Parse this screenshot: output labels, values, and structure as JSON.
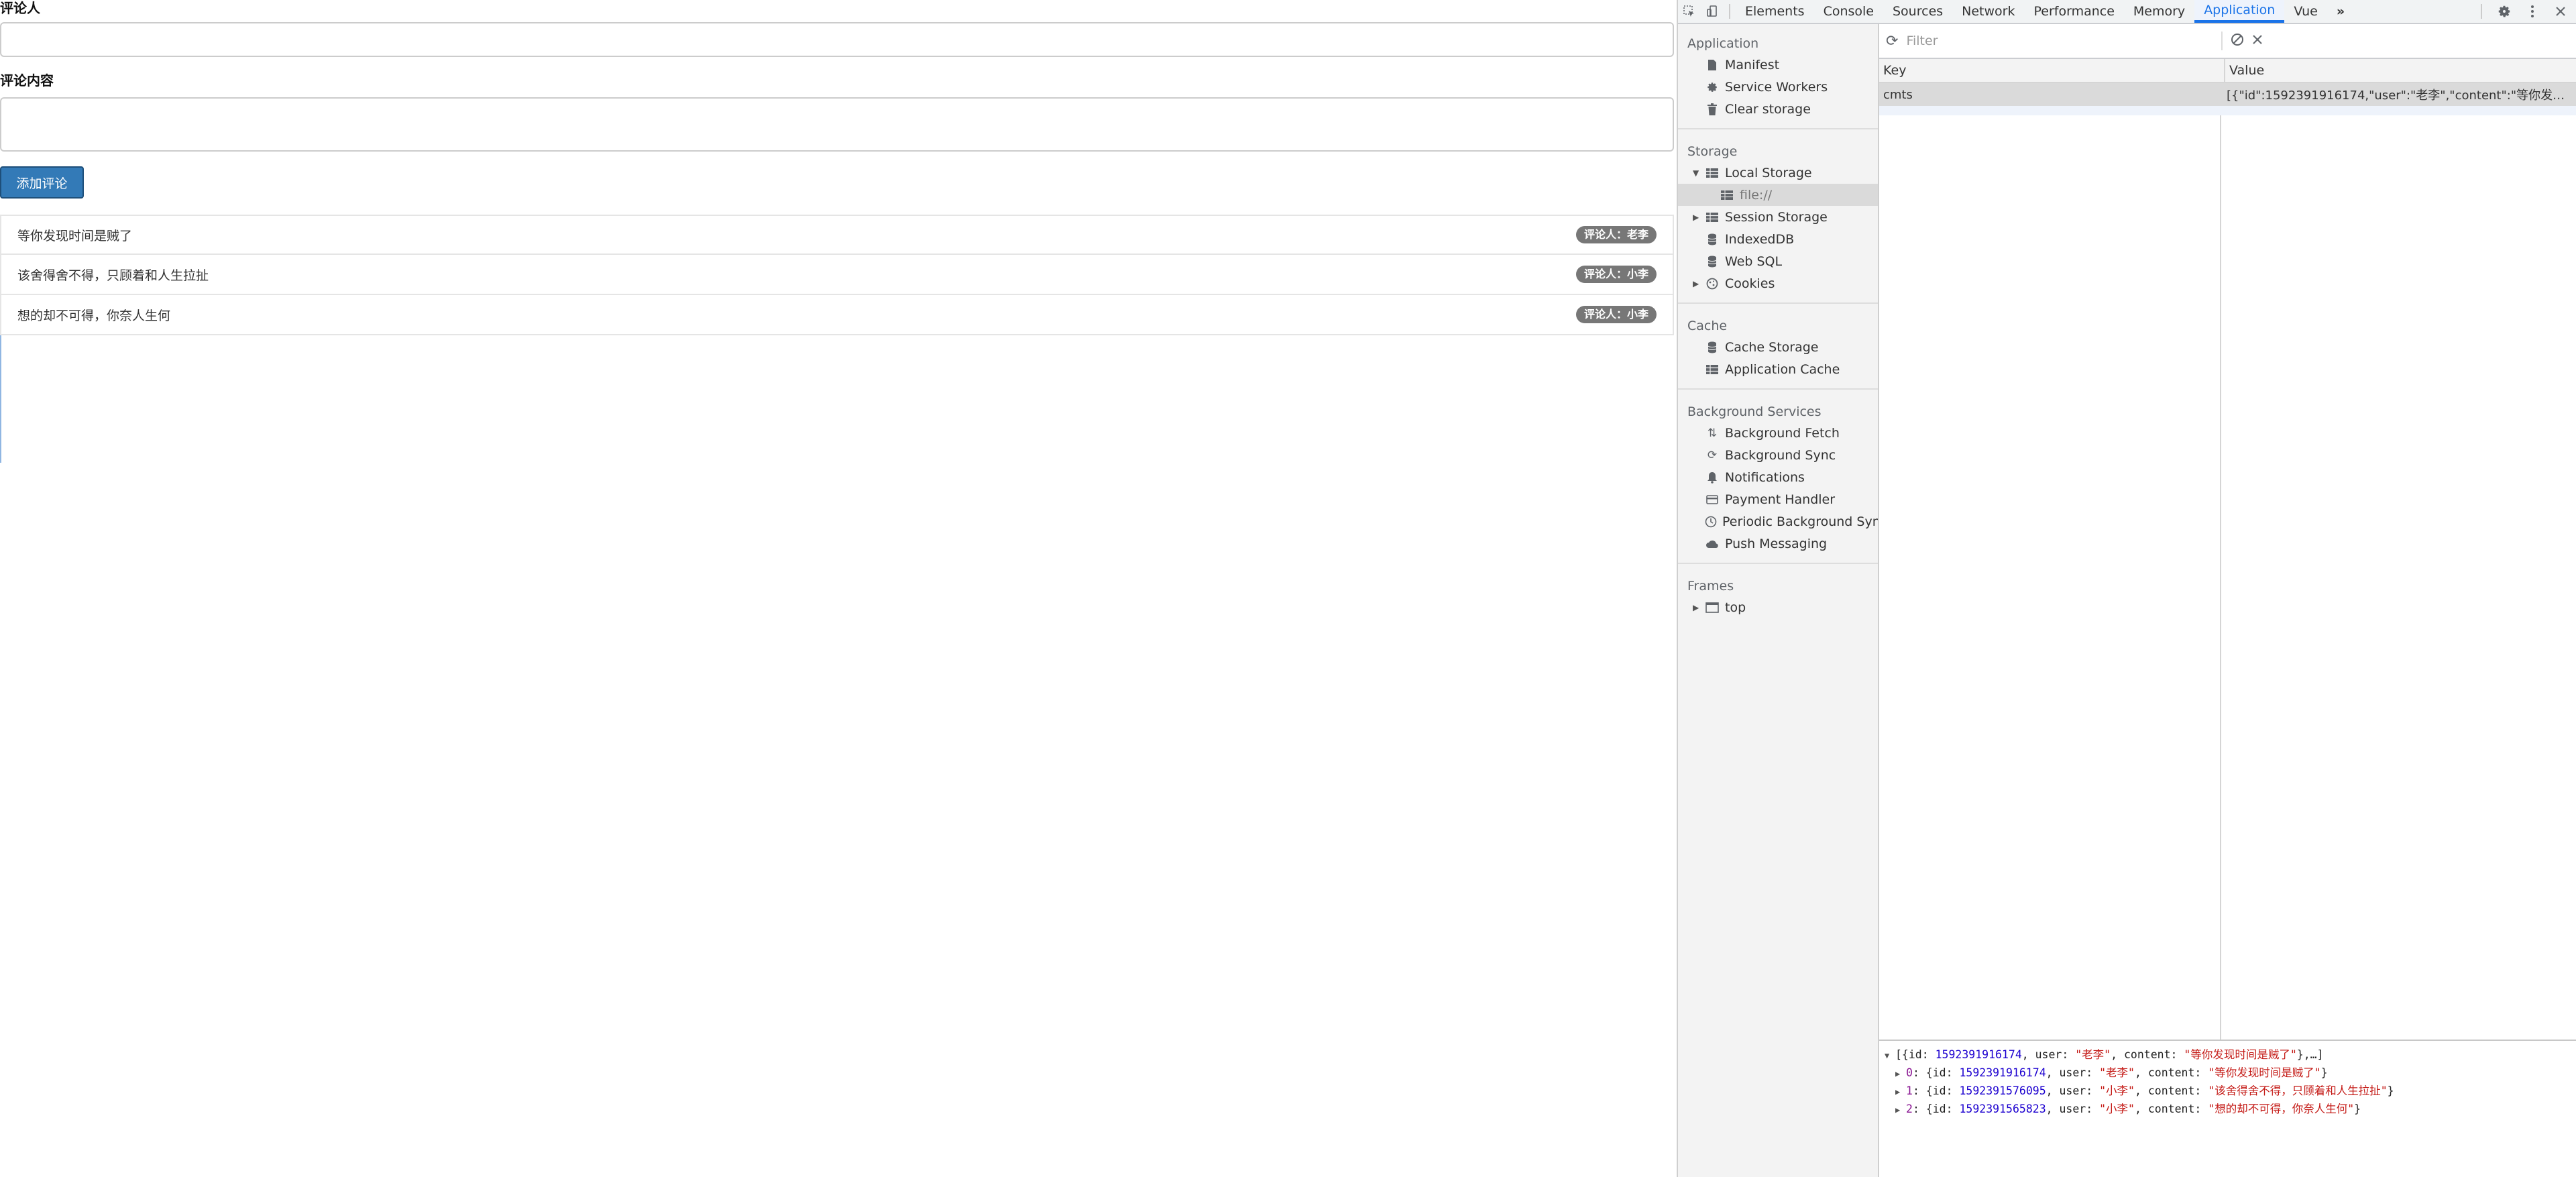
{
  "page": {
    "commenter_label": "评论人",
    "content_label": "评论内容",
    "add_button": "添加评论",
    "comments": [
      {
        "content": "等你发现时间是贼了",
        "user_badge": "评论人：老李"
      },
      {
        "content": "该舍得舍不得，只顾着和人生拉扯",
        "user_badge": "评论人：小李"
      },
      {
        "content": "想的却不可得，你奈人生何",
        "user_badge": "评论人：小李"
      }
    ]
  },
  "devtools": {
    "tabs": [
      "Elements",
      "Console",
      "Sources",
      "Network",
      "Performance",
      "Memory",
      "Application",
      "Vue"
    ],
    "active_tab": "Application",
    "overflow": "»",
    "sidebar": {
      "application": {
        "title": "Application",
        "items": [
          {
            "label": "Manifest",
            "icon": "document-icon"
          },
          {
            "label": "Service Workers",
            "icon": "gear-icon"
          },
          {
            "label": "Clear storage",
            "icon": "trash-icon"
          }
        ]
      },
      "storage": {
        "title": "Storage",
        "local_storage": "Local Storage",
        "local_storage_child": "file://",
        "session_storage": "Session Storage",
        "indexeddb": "IndexedDB",
        "websql": "Web SQL",
        "cookies": "Cookies"
      },
      "cache": {
        "title": "Cache",
        "items": [
          "Cache Storage",
          "Application Cache"
        ]
      },
      "background": {
        "title": "Background Services",
        "items": [
          "Background Fetch",
          "Background Sync",
          "Notifications",
          "Payment Handler",
          "Periodic Background Sync",
          "Push Messaging"
        ]
      },
      "frames": {
        "title": "Frames",
        "top": "top"
      }
    },
    "storage_panel": {
      "filter_placeholder": "Filter",
      "col_key": "Key",
      "col_value": "Value",
      "rows": [
        {
          "key": "cmts",
          "value": "[{\"id\":1592391916174,\"user\":\"老李\",\"content\":\"等你发…"
        }
      ]
    },
    "console": {
      "summary_prefix": "[{id: ",
      "summary_id": "1592391916174",
      "summary_mid": ", user: ",
      "summary_user": "\"老李\"",
      "summary_mid2": ", content: ",
      "summary_content": "\"等你发现时间是贼了\"",
      "summary_suffix": "},…]",
      "entries": [
        {
          "idx": "0",
          "id": "1592391916174",
          "user": "\"老李\"",
          "content": "\"等你发现时间是贼了\""
        },
        {
          "idx": "1",
          "id": "1592391576095",
          "user": "\"小李\"",
          "content": "\"该舍得舍不得，只顾着和人生拉扯\""
        },
        {
          "idx": "2",
          "id": "1592391565823",
          "user": "\"小李\"",
          "content": "\"想的却不可得，你奈人生何\""
        }
      ]
    }
  }
}
